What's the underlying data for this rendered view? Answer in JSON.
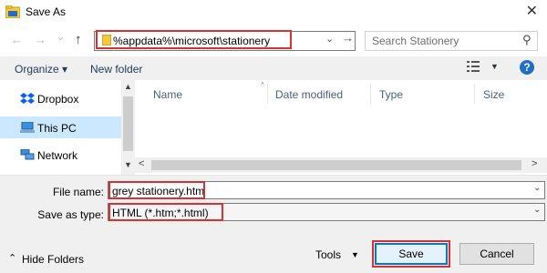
{
  "window": {
    "title": "Save As",
    "close_glyph": "✕"
  },
  "nav": {
    "back_glyph": "←",
    "forward_glyph": "→",
    "recent_glyph": "⌄",
    "up_glyph": "↑"
  },
  "address": {
    "value": "%appdata%\\microsoft\\stationery",
    "dropdown_glyph": "⌄",
    "go_glyph": "→"
  },
  "search": {
    "placeholder": "Search Stationery",
    "icon_glyph": "⚲"
  },
  "toolbar": {
    "organize": "Organize ▾",
    "new_folder": "New folder",
    "view_dropdown_glyph": "▼",
    "help_glyph": "?"
  },
  "sidebar": {
    "items": [
      {
        "label": "Dropbox",
        "icon": "dropbox-icon",
        "selected": false
      },
      {
        "label": "This PC",
        "icon": "computer-icon",
        "selected": true
      },
      {
        "label": "Network",
        "icon": "network-icon",
        "selected": false
      }
    ]
  },
  "columns": [
    "Name",
    "Date modified",
    "Type",
    "Size"
  ],
  "scroll": {
    "up": "▲",
    "down": "▼",
    "left": "<",
    "right": ">"
  },
  "form": {
    "file_name_label": "File name:",
    "file_name_value": "grey stationery.htm",
    "save_type_label": "Save as type:",
    "save_type_value": "HTML (*.htm;*.html)",
    "dropdown_glyph": "⌄"
  },
  "footer": {
    "hide_folders": "Hide Folders",
    "hide_glyph": "⌃",
    "tools": "Tools",
    "tools_glyph": "▼",
    "save": "Save",
    "cancel": "Cancel"
  },
  "colors": {
    "highlight_border": "#d9312f",
    "selection": "#cce8ff",
    "accent": "#0078d7"
  }
}
